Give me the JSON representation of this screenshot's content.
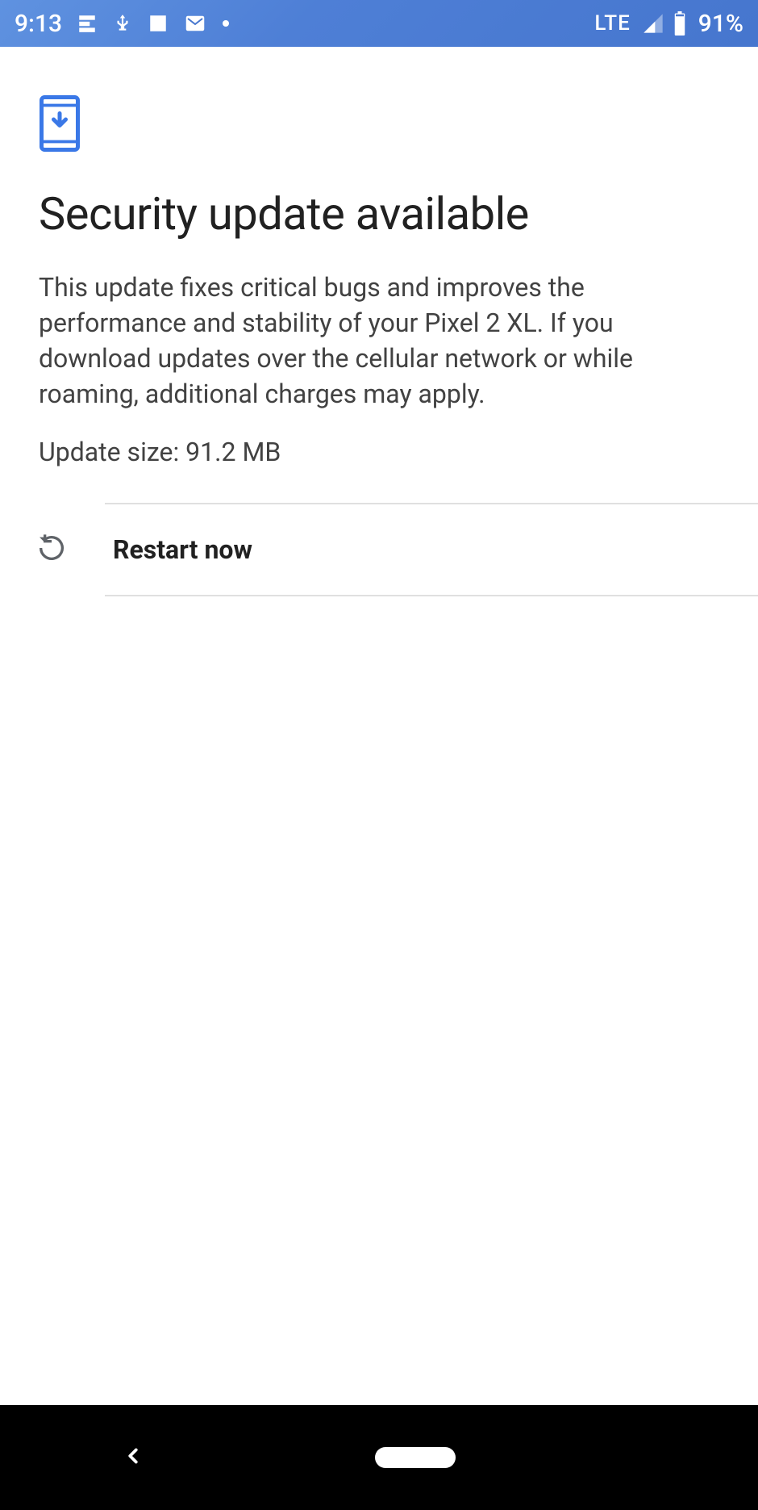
{
  "status": {
    "time": "9:13",
    "network_label": "LTE",
    "battery_pct": "91%"
  },
  "page": {
    "title": "Security update available",
    "description": "This update fixes critical bugs and improves the performance and stability of your Pixel 2 XL. If you download updates over the cellular network or while roaming, additional charges may apply.",
    "update_size": "Update size: 91.2 MB",
    "action_label": "Restart now"
  }
}
